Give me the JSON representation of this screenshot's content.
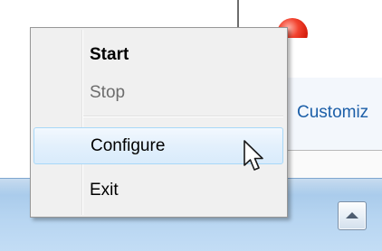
{
  "context_menu": {
    "items": [
      {
        "label": "Start",
        "state": "default",
        "bold": true
      },
      {
        "label": "Stop",
        "state": "disabled"
      },
      {
        "label": "Configure",
        "state": "highlighted"
      },
      {
        "label": "Exit",
        "state": "default"
      }
    ]
  },
  "background_window": {
    "link_text": "Customiz",
    "status_icon": "red-status-dot-icon"
  },
  "taskbar": {
    "tray_button_icon": "chevron-up-icon"
  },
  "cursor": {
    "icon": "arrow-pointer-icon"
  },
  "colors": {
    "menu_background": "#f0f0f0",
    "highlight_border": "#a8d8f8",
    "highlight_fill": "#e3f0fc",
    "link": "#1c5fa8",
    "status_dot": "#f2422e",
    "taskbar": "#b7d5f1",
    "disabled_text": "#6d6d6d"
  }
}
